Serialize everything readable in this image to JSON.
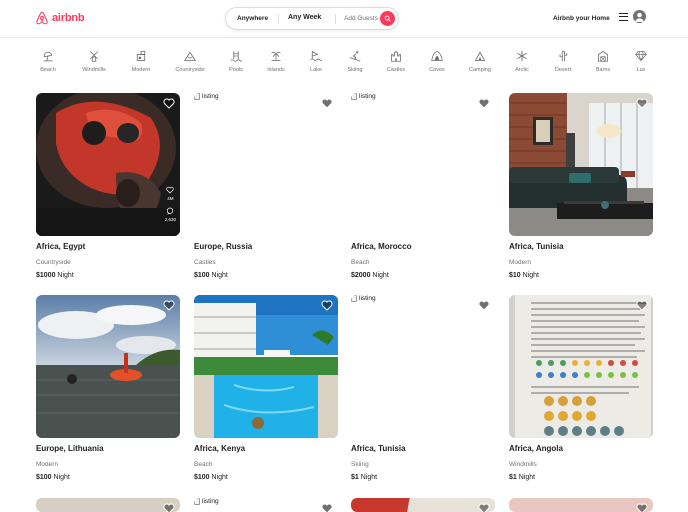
{
  "header": {
    "logo_text": "airbnb",
    "search": {
      "anywhere": "Anywhere",
      "week": "Any Week",
      "guests": "Add Guests"
    },
    "host_link": "Airbnb your Home"
  },
  "categories": [
    {
      "label": "Beach",
      "icon": "beach-icon"
    },
    {
      "label": "Windmills",
      "icon": "windmill-icon"
    },
    {
      "label": "Modern",
      "icon": "modern-house-icon"
    },
    {
      "label": "Countryside",
      "icon": "mountain-icon"
    },
    {
      "label": "Pools",
      "icon": "pool-icon"
    },
    {
      "label": "Islands",
      "icon": "island-icon"
    },
    {
      "label": "Lake",
      "icon": "lake-icon"
    },
    {
      "label": "Skiing",
      "icon": "skiing-icon"
    },
    {
      "label": "Castles",
      "icon": "castle-icon"
    },
    {
      "label": "Caves",
      "icon": "cave-icon"
    },
    {
      "label": "Camping",
      "icon": "tent-icon"
    },
    {
      "label": "Arctic",
      "icon": "snowflake-icon"
    },
    {
      "label": "Desert",
      "icon": "cactus-icon"
    },
    {
      "label": "Barns",
      "icon": "barn-icon"
    },
    {
      "label": "Lux",
      "icon": "diamond-icon"
    }
  ],
  "listings": [
    {
      "location": "Africa, Egypt",
      "category": "Countryside",
      "price": "$1000",
      "unit": "Night",
      "image": "photo",
      "photo_stats": {
        "likes": "4M",
        "comments": "2,630"
      }
    },
    {
      "location": "Europe, Russia",
      "category": "Castles",
      "price": "$100",
      "unit": "Night",
      "image": "broken",
      "alt": "listing"
    },
    {
      "location": "Africa, Morocco",
      "category": "Beach",
      "price": "$2000",
      "unit": "Night",
      "image": "broken",
      "alt": "listing"
    },
    {
      "location": "Africa, Tunisia",
      "category": "Modern",
      "price": "$10",
      "unit": "Night",
      "image": "photo"
    },
    {
      "location": "Europe, Lithuania",
      "category": "Modern",
      "price": "$100",
      "unit": "Night",
      "image": "photo"
    },
    {
      "location": "Africa, Kenya",
      "category": "Beach",
      "price": "$100",
      "unit": "Night",
      "image": "photo"
    },
    {
      "location": "Africa, Tunisia",
      "category": "Skiing",
      "price": "$1",
      "unit": "Night",
      "image": "broken",
      "alt": "listing"
    },
    {
      "location": "Africa, Angola",
      "category": "Windmills",
      "price": "$1",
      "unit": "Night",
      "image": "photo"
    }
  ],
  "third_row_alt": "listing",
  "colors": {
    "brand": "#ff385c",
    "text": "#222222",
    "muted": "#717171",
    "border": "#dddddd"
  }
}
